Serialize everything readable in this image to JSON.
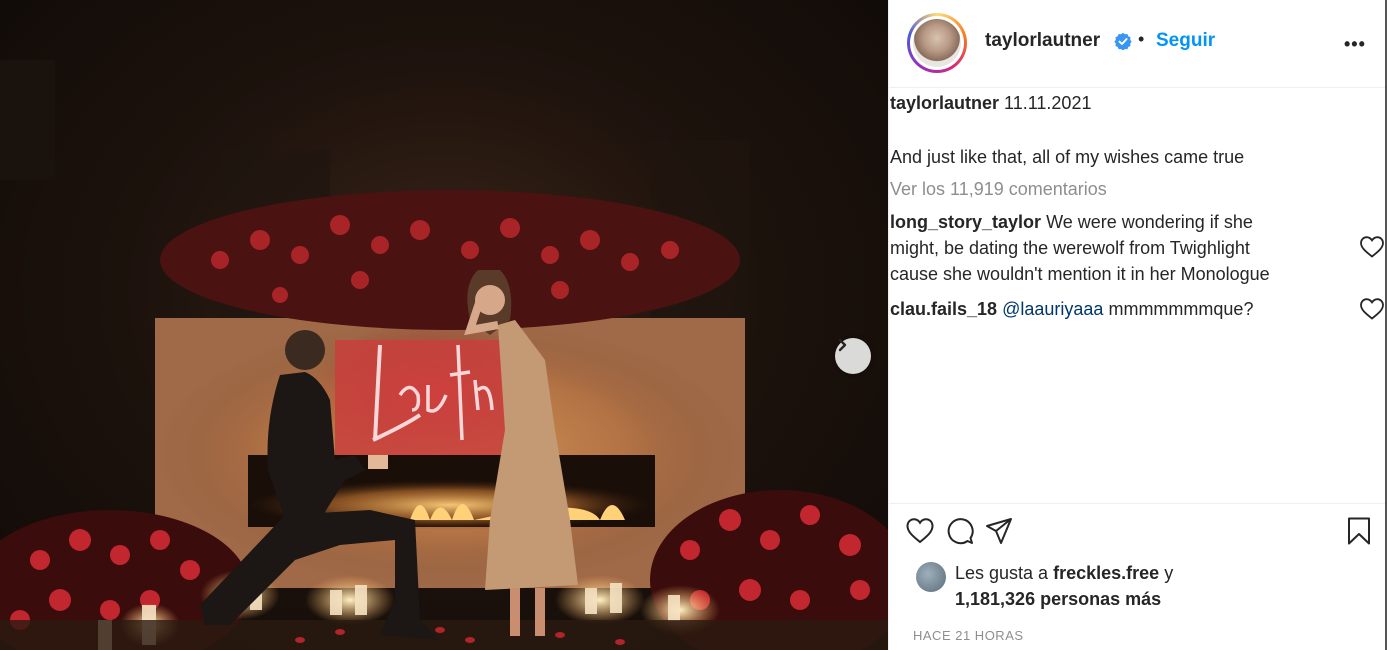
{
  "post": {
    "image_description_alt": "",
    "next_icon": "chevron-right-icon"
  },
  "header": {
    "username": "taylorlautner",
    "verified_icon": "verified-badge-icon",
    "separator": "•",
    "follow_label": "Seguir",
    "more_label": "•••"
  },
  "caption": {
    "username": "taylorlautner",
    "date": "11.11.2021",
    "text": "And just like that, all of my wishes came true",
    "view_comments": "Ver los 11,919 comentarios"
  },
  "comments": [
    {
      "username": "long_story_taylor",
      "lines": [
        "We were wondering if she",
        "might, be dating the werewolf from Twighlight",
        "cause she wouldn't mention it in her Monologue"
      ],
      "like_icon": "heart-icon"
    },
    {
      "username": "clau.fails_18",
      "mention": "@laauriyaaa",
      "text": "mmmmmmmque?",
      "like_icon": "heart-icon"
    }
  ],
  "actions": {
    "like_icon": "heart-icon",
    "comment_icon": "comment-icon",
    "share_icon": "paper-plane-icon",
    "save_icon": "bookmark-icon"
  },
  "likes": {
    "prefix": "Les gusta a",
    "user": "freckles.free",
    "connector": "y",
    "count": "1,181,326",
    "suffix": "personas más"
  },
  "timestamp": "HACE 21 HORAS",
  "colors": {
    "link_blue": "#0095f6",
    "text": "#262626",
    "muted": "#8e8e8e",
    "neon": "#ff5a6e"
  }
}
